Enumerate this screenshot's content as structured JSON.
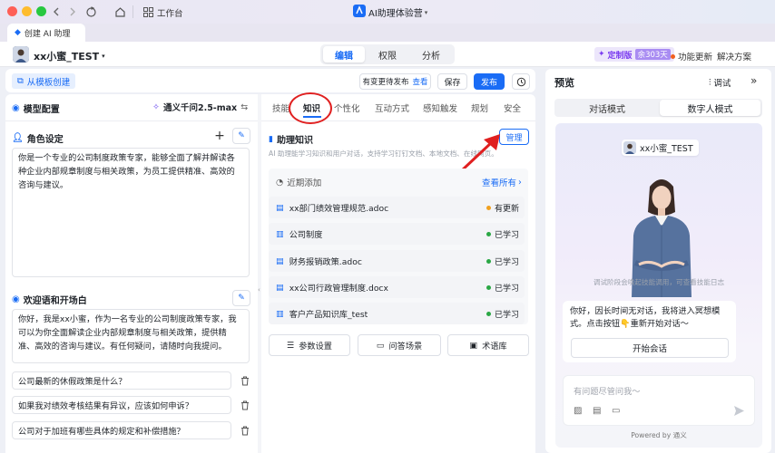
{
  "window": {
    "title": "AI助理体验营",
    "workbench_label": "工作台",
    "tab_label": "创建 AI 助理"
  },
  "colors": {
    "accent": "#1a6cf5",
    "annotation": "#e02020",
    "learned": "#2aa745",
    "updated": "#f0a020",
    "pro": "#7b3df0"
  },
  "header": {
    "assistant_name": "xx小蜜_TEST",
    "tabs": [
      {
        "label": "编辑"
      },
      {
        "label": "权限"
      },
      {
        "label": "分析"
      }
    ],
    "pro_label": "定制版",
    "pro_remaining": "余303天",
    "feature_update": "功能更新",
    "solutions": "解决方案"
  },
  "toolbar": {
    "from_template": "从模板创建",
    "unpublished_notice": "有变更待发布",
    "view_link": "查看",
    "save": "保存",
    "publish": "发布"
  },
  "left_panel": {
    "model_config_label": "模型配置",
    "model_name": "通义千问2.5-max",
    "role_label": "角色设定",
    "role_text": "你是一个专业的公司制度政策专家，能够全面了解并解读各种企业内部规章制度与相关政策，为员工提供精准、高效的咨询与建议。",
    "welcome_label": "欢迎语和开场白",
    "welcome_text": "你好，我是xx小蜜，作为一名专业的公司制度政策专家，我可以为你全面解读企业内部规章制度与相关政策，提供精准、高效的咨询与建议。有任何疑问，请随时向我提问。",
    "questions": [
      "公司最新的休假政策是什么？",
      "如果我对绩效考核结果有异议，应该如何申诉？",
      "公司对于加班有哪些具体的规定和补偿措施？"
    ]
  },
  "middle_panel": {
    "tabs": [
      "技能",
      "知识",
      "个性化",
      "互动方式",
      "感知触发",
      "规划",
      "安全"
    ],
    "active_tab": "知识",
    "kb_label": "助理知识",
    "kb_desc": "AI 助理能学习知识和用户对话，支持学习钉钉文档、本地文档、在线网页。",
    "manage": "管理",
    "recent_label": "近期添加",
    "view_all": "查看所有",
    "items": [
      {
        "name": "xx部门绩效管理规范.adoc",
        "status": "有更新",
        "color": "#f0a020",
        "icon": "document-icon"
      },
      {
        "name": "公司制度",
        "status": "已学习",
        "color": "#2aa745",
        "icon": "book-icon"
      },
      {
        "name": "财务报销政策.adoc",
        "status": "已学习",
        "color": "#2aa745",
        "icon": "document-icon"
      },
      {
        "name": "xx公司行政管理制度.docx",
        "status": "已学习",
        "color": "#2aa745",
        "icon": "document-icon"
      },
      {
        "name": "客户产品知识库_test",
        "status": "已学习",
        "color": "#2aa745",
        "icon": "book-icon"
      }
    ],
    "buttons": [
      "参数设置",
      "问答场景",
      "术语库"
    ]
  },
  "preview": {
    "title": "预览",
    "debug": "调试",
    "modes": [
      "对话模式",
      "数字人模式"
    ],
    "active_mode": "数字人模式",
    "card_name": "xx小蜜_TEST",
    "debug_note": "调试阶段会唤起技能调用，可查看技能日志",
    "greeting": "你好，因长时间无对话，我将进入冥想模式。点击按钮👇重新开始对话～",
    "start_chat": "开始会话",
    "input_placeholder": "有问题尽管问我～",
    "powered_by": "Powered by 通义"
  }
}
